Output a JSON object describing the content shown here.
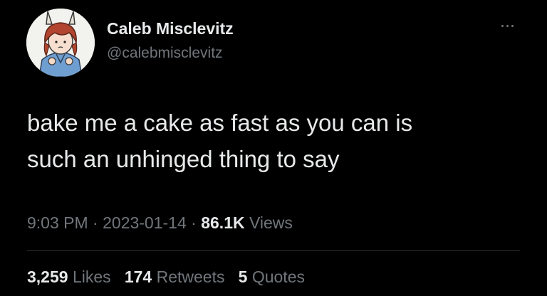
{
  "author": {
    "name": "Caleb Misclevitz",
    "handle": "@calebmisclevitz"
  },
  "tweet": {
    "line1": "bake me a cake as fast as you can is",
    "line2": "such an unhinged thing to say"
  },
  "meta": {
    "time": "9:03 PM",
    "separator": "·",
    "date": "2023-01-14",
    "views_count": "86.1K",
    "views_label": "Views"
  },
  "stats": {
    "likes_count": "3,259",
    "likes_label": "Likes",
    "retweets_count": "174",
    "retweets_label": "Retweets",
    "quotes_count": "5",
    "quotes_label": "Quotes"
  },
  "icons": {
    "more": "more-options-icon"
  },
  "colors": {
    "background": "#000000",
    "primary_text": "#e7e9ea",
    "secondary_text": "#71767b",
    "divider": "#2f3336"
  }
}
